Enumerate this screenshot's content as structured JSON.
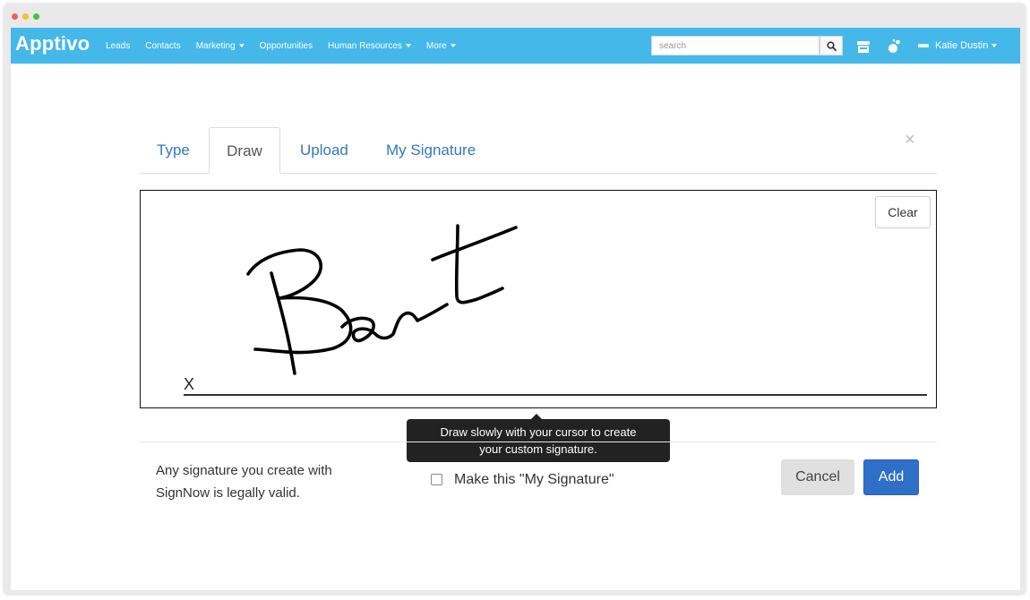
{
  "window": {
    "controls": [
      "close",
      "minimize",
      "maximize"
    ]
  },
  "navbar": {
    "logo": "Apptivo",
    "items": [
      {
        "label": "Leads",
        "dropdown": false
      },
      {
        "label": "Contacts",
        "dropdown": false
      },
      {
        "label": "Marketing",
        "dropdown": true
      },
      {
        "label": "Opportunities",
        "dropdown": false
      },
      {
        "label": "Human Resources",
        "dropdown": true
      },
      {
        "label": "More",
        "dropdown": true
      }
    ],
    "search": {
      "placeholder": "search",
      "value": ""
    },
    "icons": [
      "search-icon",
      "store-icon",
      "apps-icon"
    ],
    "user": {
      "name": "Katie Dustin"
    },
    "bg_color": "#45b8ea"
  },
  "dialog": {
    "tabs": [
      {
        "label": "Type",
        "active": false
      },
      {
        "label": "Draw",
        "active": true
      },
      {
        "label": "Upload",
        "active": false
      },
      {
        "label": "My Signature",
        "active": false
      }
    ],
    "close_symbol": "×",
    "canvas": {
      "clear_label": "Clear",
      "signature_marker": "X"
    },
    "tooltip": {
      "line1": "Draw slowly with your cursor to create",
      "line2": "your custom signature."
    },
    "legal": {
      "line1": "Any signature you create with",
      "line2": "SignNow is legally valid."
    },
    "checkbox": {
      "label": "Make this \"My Signature\"",
      "checked": false
    },
    "buttons": {
      "cancel": "Cancel",
      "add": "Add"
    },
    "colors": {
      "primary": "#2e6fc7",
      "link": "#337ab7"
    }
  }
}
